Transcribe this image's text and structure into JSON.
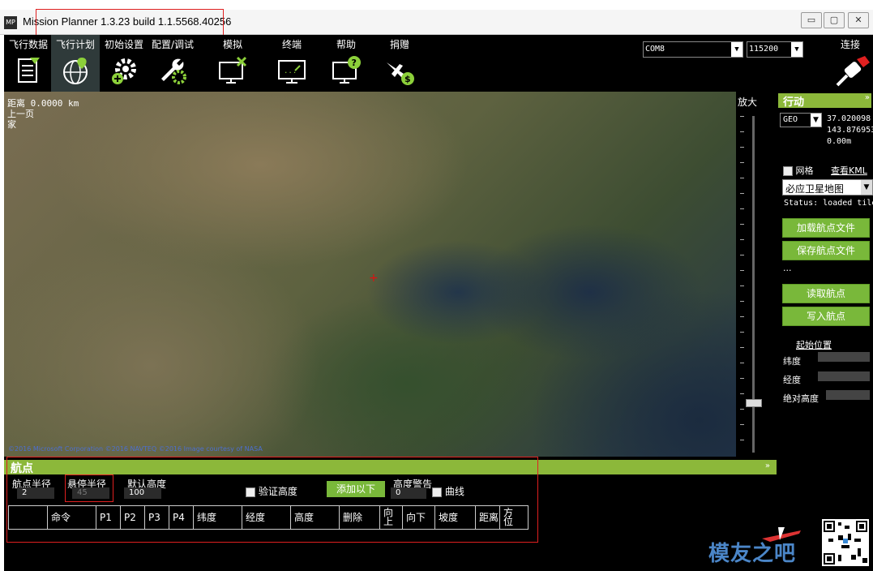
{
  "window": {
    "title": "Mission Planner 1.3.23 build 1.1.5568.40256",
    "app_icon_text": "MP"
  },
  "toolbar": {
    "menu": [
      {
        "label": "飞行数据",
        "icon": "flight-data-icon"
      },
      {
        "label": "飞行计划",
        "icon": "globe-icon"
      },
      {
        "label": "初始设置",
        "icon": "gear-add-icon"
      },
      {
        "label": "配置/调试",
        "icon": "wrench-icon"
      },
      {
        "label": "模拟",
        "icon": "simulation-icon"
      },
      {
        "label": "终端",
        "icon": "terminal-icon"
      },
      {
        "label": "帮助",
        "icon": "help-icon"
      },
      {
        "label": "捐赠",
        "icon": "donate-icon"
      }
    ],
    "port": "COM8",
    "baud": "115200",
    "connect_label": "连接"
  },
  "map": {
    "distance": "距离  0.0000 km",
    "prev_page": "上一页",
    "home": "家",
    "copyright": "©2016 Microsoft Corporation ©2016 NAVTEQ ©2016 Image courtesy of NASA"
  },
  "zoom": {
    "label": "放大",
    "level_fraction": 0.15
  },
  "right_panel": {
    "title": "行动",
    "coord_mode": "GEO",
    "lat": "37.020098",
    "lng": "143.876953",
    "alt": "0.00m",
    "grid_label": "网格",
    "kml_link": "查看KML",
    "map_provider": "必应卫星地图",
    "status": "Status: loaded tiles",
    "load_wp_file": "加载航点文件",
    "save_wp_file": "保存航点文件",
    "ellipsis": "...",
    "read_wp": "读取航点",
    "write_wp": "写入航点",
    "home_location": "起始位置",
    "lat_label": "纬度",
    "lng_label": "经度",
    "abs_alt_label": "绝对高度"
  },
  "waypoints": {
    "title": "航点",
    "wp_radius_label": "航点半径",
    "wp_radius": "2",
    "loiter_radius_label": "悬停半径",
    "loiter_radius": "45",
    "default_alt_label": "默认高度",
    "default_alt": "100",
    "verify_height": "验证高度",
    "add_below": "添加以下",
    "alt_warning_label": "高度警告",
    "alt_warning": "0",
    "spline": "曲线",
    "columns": [
      "",
      "命令",
      "P1",
      "P2",
      "P3",
      "P4",
      "纬度",
      "经度",
      "高度",
      "删除",
      "向上",
      "向下",
      "坡度",
      "距离",
      "方位"
    ]
  },
  "branding": {
    "logo_text": "模友之吧"
  }
}
